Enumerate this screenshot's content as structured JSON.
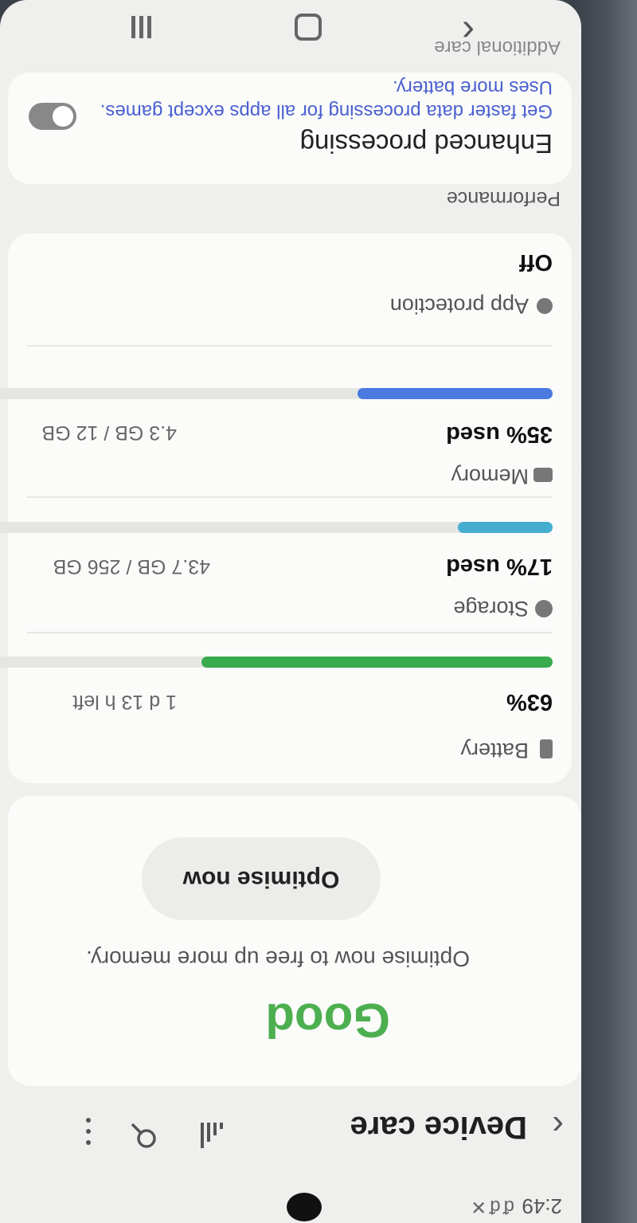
{
  "status_bar": {
    "time": "2:49",
    "icons": [
      "notification-icon",
      "notification-icon",
      "close-icon"
    ]
  },
  "header": {
    "title": "Device care",
    "icons": [
      "back-icon",
      "signal-icon",
      "search-icon",
      "more-icon"
    ]
  },
  "status": {
    "word": "Good",
    "description": "Optimise now to free up more memory.",
    "button_label": "Optimise now",
    "accent": "#4caf50"
  },
  "metrics": {
    "battery": {
      "label": "Battery",
      "value": "63%",
      "detail": "1 d 13 h left",
      "fraction": 0.63,
      "color": "#3aaa4e"
    },
    "storage": {
      "label": "Storage",
      "value": "17% used",
      "detail": "43.7 GB / 256 GB",
      "fraction": 0.17,
      "color": "#45aed0"
    },
    "memory": {
      "label": "Memory",
      "value": "35% used",
      "detail": "4.3 GB / 12 GB",
      "fraction": 0.35,
      "color": "#4a7ae0"
    },
    "app_protection": {
      "label": "App protection",
      "value": "Off"
    }
  },
  "performance": {
    "section_label": "Performance",
    "title": "Enhanced processing",
    "description_line1": "Get faster data processing for all apps except games.",
    "description_line2": "Uses more battery.",
    "toggle_on": false
  },
  "partial": {
    "label": "Additional care"
  }
}
